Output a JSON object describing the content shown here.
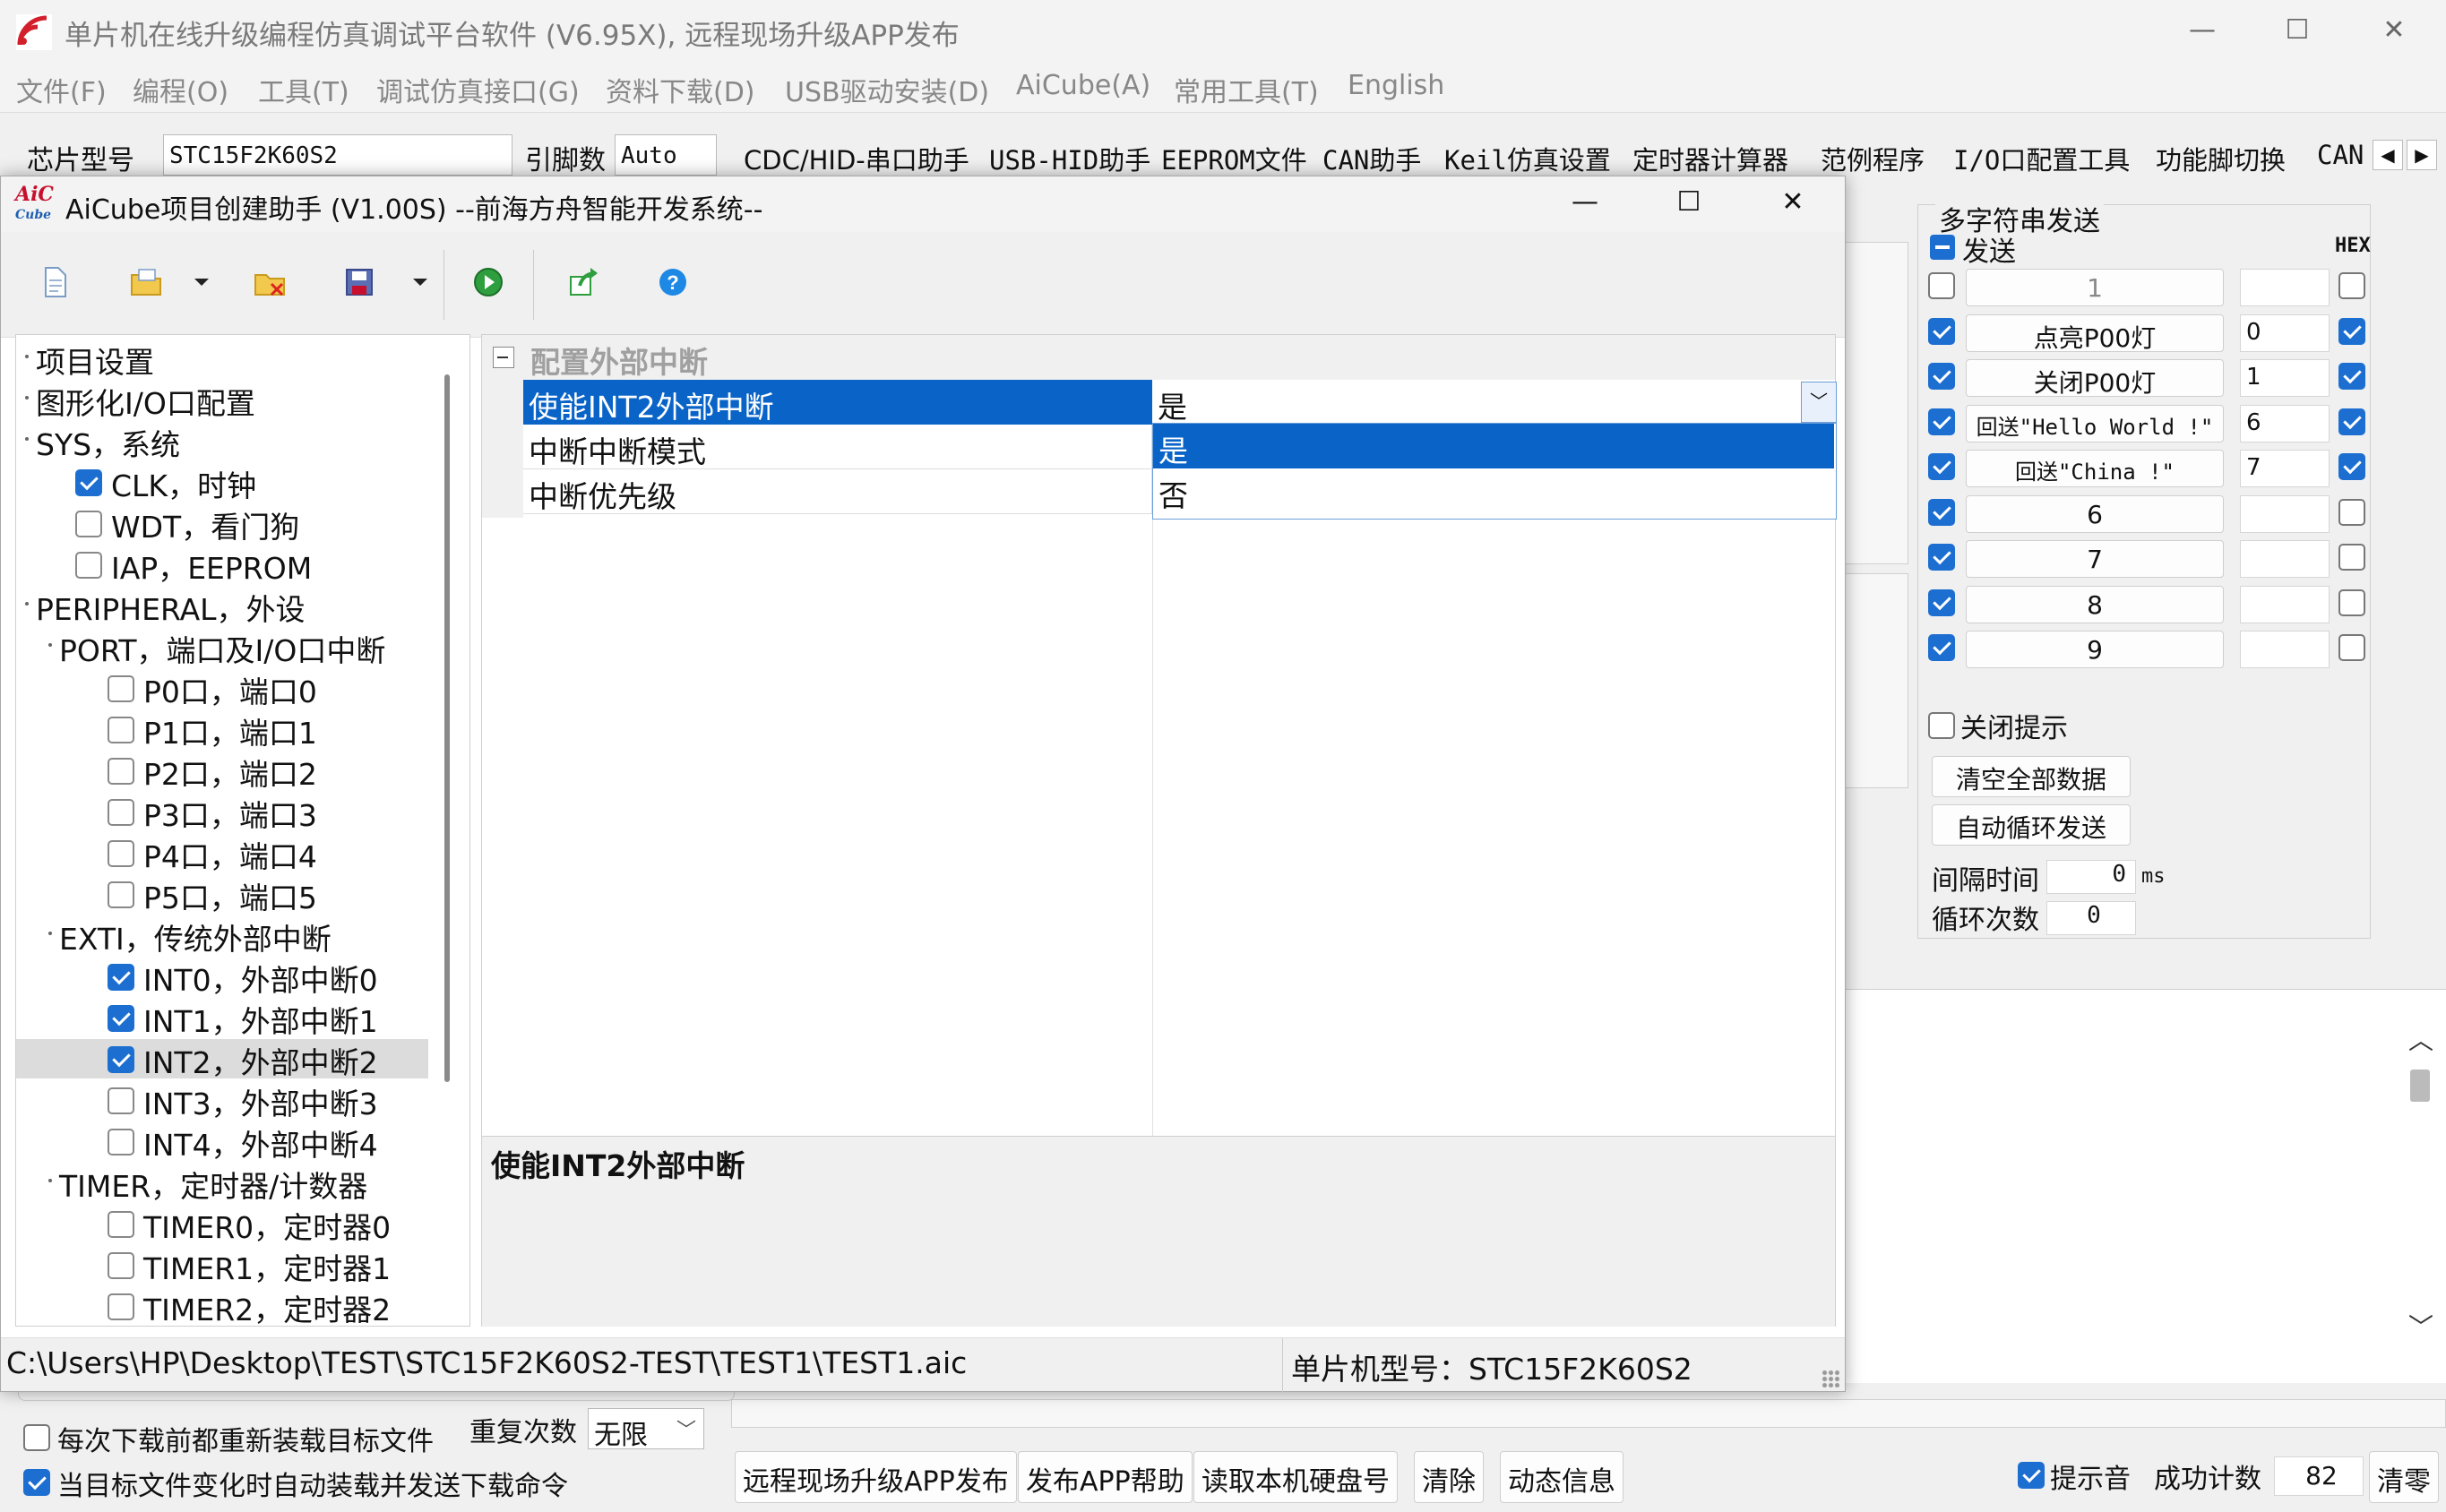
{
  "main_window": {
    "title": "单片机在线升级编程仿真调试平台软件 (V6.95X), 远程现场升级APP发布",
    "controls": {
      "minimize": "—",
      "maximize": "☐",
      "close": "✕"
    }
  },
  "menu": [
    "文件(F)",
    "编程(O)",
    "工具(T)",
    "调试仿真接口(G)",
    "资料下载(D)",
    "USB驱动安装(D)",
    "AiCube(A)",
    "常用工具(T)",
    "English"
  ],
  "chip_bar": {
    "chip_label": "芯片型号",
    "chip_value": "STC15F2K60S2",
    "pins_label": "引脚数",
    "pins_value": "Auto"
  },
  "tabs": [
    "CDC/HID-串口助手",
    "USB-HID助手",
    "EEPROM文件",
    "CAN助手",
    "Keil仿真设置",
    "定时器计算器",
    "范例程序",
    "I/O口配置工具",
    "功能脚切换",
    "CAN"
  ],
  "right_panel": {
    "group_title": "多字符串发送",
    "send_label": "发送",
    "hex_label": "HEX",
    "rows": [
      {
        "send": false,
        "label": "1",
        "value": "",
        "hex": false
      },
      {
        "send": true,
        "label": "点亮P00灯",
        "value": "0",
        "hex": true
      },
      {
        "send": true,
        "label": "关闭P00灯",
        "value": "1",
        "hex": true
      },
      {
        "send": true,
        "label": "回送\"Hello World !\"",
        "value": "6",
        "hex": true
      },
      {
        "send": true,
        "label": "回送\"China !\"",
        "value": "7",
        "hex": true
      },
      {
        "send": true,
        "label": "6",
        "value": "",
        "hex": false
      },
      {
        "send": true,
        "label": "7",
        "value": "",
        "hex": false
      },
      {
        "send": true,
        "label": "8",
        "value": "",
        "hex": false
      },
      {
        "send": true,
        "label": "9",
        "value": "",
        "hex": false
      }
    ],
    "close_hint": "关闭提示",
    "clear_all": "清空全部数据",
    "auto_loop": "自动循环发送",
    "interval_label": "间隔时间",
    "interval_value": "0",
    "interval_unit": "ms",
    "loop_label": "循环次数",
    "loop_value": "0"
  },
  "bottom": {
    "reload_each": "每次下载前都重新装载目标文件",
    "auto_reload": "当目标文件变化时自动装载并发送下载命令",
    "repeat_label": "重复次数",
    "repeat_value": "无限",
    "buttons": [
      "远程现场升级APP发布",
      "发布APP帮助",
      "读取本机硬盘号",
      "清除",
      "动态信息"
    ],
    "beep_label": "提示音",
    "success_label": "成功计数",
    "success_value": "82",
    "clear_label": "清零"
  },
  "dialog": {
    "title": "AiCube项目创建助手 (V1.00S) --前海方舟智能开发系统--",
    "controls": {
      "minimize": "—",
      "maximize": "☐",
      "close": "✕"
    },
    "tree": [
      {
        "label": "项目设置",
        "level": 0,
        "check": null
      },
      {
        "label": "图形化I/O口配置",
        "level": 0,
        "check": null
      },
      {
        "label": "SYS，系统",
        "level": 0,
        "check": null
      },
      {
        "label": "CLK，时钟",
        "level": 1,
        "check": true
      },
      {
        "label": "WDT，看门狗",
        "level": 1,
        "check": false
      },
      {
        "label": "IAP，EEPROM",
        "level": 1,
        "check": false
      },
      {
        "label": "PERIPHERAL，外设",
        "level": 0,
        "check": null
      },
      {
        "label": "PORT，端口及I/O口中断",
        "level": 1,
        "check": null
      },
      {
        "label": "P0口，端口0",
        "level": 2,
        "check": false
      },
      {
        "label": "P1口，端口1",
        "level": 2,
        "check": false
      },
      {
        "label": "P2口，端口2",
        "level": 2,
        "check": false
      },
      {
        "label": "P3口，端口3",
        "level": 2,
        "check": false
      },
      {
        "label": "P4口，端口4",
        "level": 2,
        "check": false
      },
      {
        "label": "P5口，端口5",
        "level": 2,
        "check": false
      },
      {
        "label": "EXTI，传统外部中断",
        "level": 1,
        "check": null
      },
      {
        "label": "INT0，外部中断0",
        "level": 2,
        "check": true
      },
      {
        "label": "INT1，外部中断1",
        "level": 2,
        "check": true
      },
      {
        "label": "INT2，外部中断2",
        "level": 2,
        "check": true,
        "selected": true
      },
      {
        "label": "INT3，外部中断3",
        "level": 2,
        "check": false
      },
      {
        "label": "INT4，外部中断4",
        "level": 2,
        "check": false
      },
      {
        "label": "TIMER，定时器/计数器",
        "level": 1,
        "check": null
      },
      {
        "label": "TIMER0，定时器0",
        "level": 2,
        "check": false
      },
      {
        "label": "TIMER1，定时器1",
        "level": 2,
        "check": false
      },
      {
        "label": "TIMER2，定时器2",
        "level": 2,
        "check": false
      }
    ],
    "property_group": "配置外部中断",
    "properties": [
      {
        "name": "使能INT2外部中断",
        "value": "是"
      },
      {
        "name": "中断中断模式",
        "value": ""
      },
      {
        "name": "中断优先级",
        "value": ""
      }
    ],
    "dropdown_options": [
      "是",
      "否"
    ],
    "description": "使能INT2外部中断",
    "status_path": "C:\\Users\\HP\\Desktop\\TEST\\STC15F2K60S2-TEST\\TEST1\\TEST1.aic",
    "status_chip": "单片机型号：STC15F2K60S2"
  },
  "colors": {
    "accent": "#1c6fd1",
    "selection": "#0a64c8"
  }
}
